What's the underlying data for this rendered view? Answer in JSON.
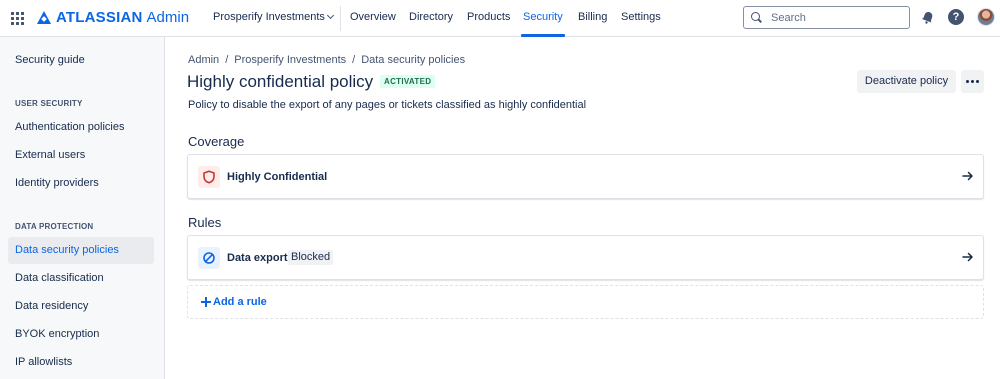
{
  "brand": {
    "name": "ATLASSIAN",
    "product": "Admin",
    "color": "#0C66E4"
  },
  "topnav": {
    "org": "Prosperify Investments",
    "items": [
      {
        "label": "Overview"
      },
      {
        "label": "Directory"
      },
      {
        "label": "Products"
      },
      {
        "label": "Security",
        "active": true
      },
      {
        "label": "Billing"
      },
      {
        "label": "Settings"
      }
    ],
    "search_placeholder": "Search"
  },
  "sidebar": {
    "top_item": "Security guide",
    "user_security_heading": "USER SECURITY",
    "user_security": [
      "Authentication policies",
      "External users",
      "Identity providers"
    ],
    "data_protection_heading": "DATA PROTECTION",
    "data_protection": [
      "Data security policies",
      "Data classification",
      "Data residency",
      "BYOK encryption",
      "IP allowlists"
    ],
    "selected": "Data security policies"
  },
  "breadcrumb": [
    "Admin",
    "Prosperify Investments",
    "Data security policies"
  ],
  "page": {
    "title": "Highly confidential policy",
    "status": "ACTIVATED",
    "description": "Policy to disable the export of any pages or tickets classified as highly confidential",
    "deactivate_label": "Deactivate policy"
  },
  "coverage": {
    "title": "Coverage",
    "item": {
      "label": "Highly Confidential",
      "icon": "shield-icon",
      "icon_color": "#C9372C"
    }
  },
  "rules": {
    "title": "Rules",
    "item": {
      "label": "Data export",
      "tag": "Blocked",
      "icon": "block-icon",
      "icon_color": "#0C66E4"
    },
    "add_label": "Add a rule"
  }
}
